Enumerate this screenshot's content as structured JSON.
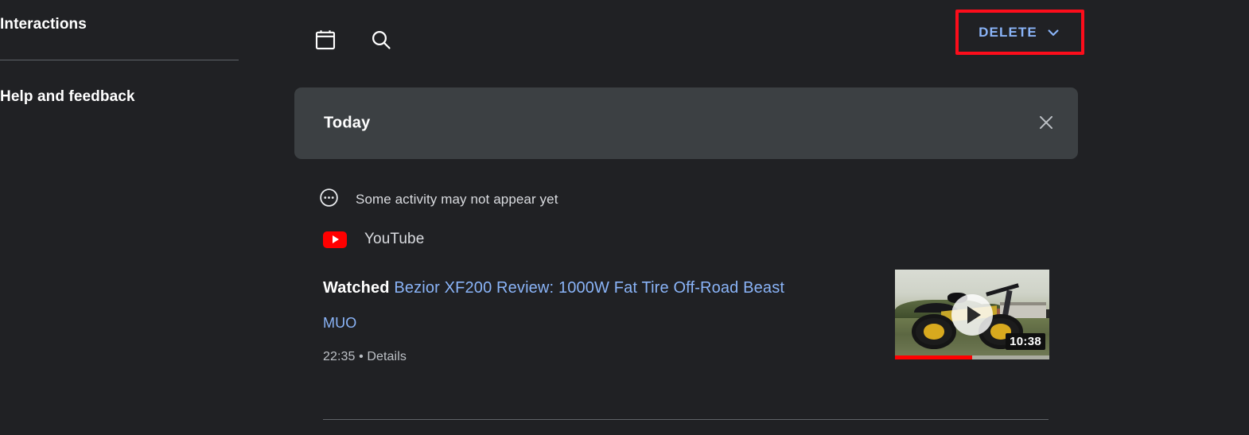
{
  "sidebar": {
    "items": [
      {
        "label": "Interactions"
      },
      {
        "label": "Help and feedback"
      }
    ]
  },
  "toolbar": {
    "calendar_icon": "calendar-icon",
    "search_icon": "search-icon",
    "delete_label": "DELETE",
    "delete_chevron_icon": "chevron-down-icon",
    "highlight_color": "#fc0d1b",
    "link_color": "#8ab4f8"
  },
  "main": {
    "date_card": {
      "label": "Today",
      "close_icon": "close-icon",
      "background": "#3c4043"
    },
    "notice": {
      "icon": "more-horiz-circle-icon",
      "text": "Some activity may not appear yet"
    },
    "provider": {
      "icon": "youtube-icon",
      "name": "YouTube",
      "close_icon": "close-icon",
      "brand_color": "#ff0000"
    },
    "activity": {
      "action_label": "Watched",
      "title": "Bezior XF200 Review: 1000W Fat Tire Off-Road Beast",
      "channel": "MUO",
      "time": "22:35",
      "separator": "•",
      "details_label": "Details",
      "thumbnail": {
        "alt": "electric fat tire bike standing in a grassy field",
        "play_icon": "play-icon",
        "duration": "10:38",
        "watch_progress_percent": 50,
        "progress_color": "#ff0000"
      }
    }
  },
  "theme": {
    "page_background": "#202124",
    "text_primary": "#ffffff",
    "text_secondary": "#dadce0",
    "text_muted": "#bdc1c6",
    "divider": "#5f6368"
  }
}
